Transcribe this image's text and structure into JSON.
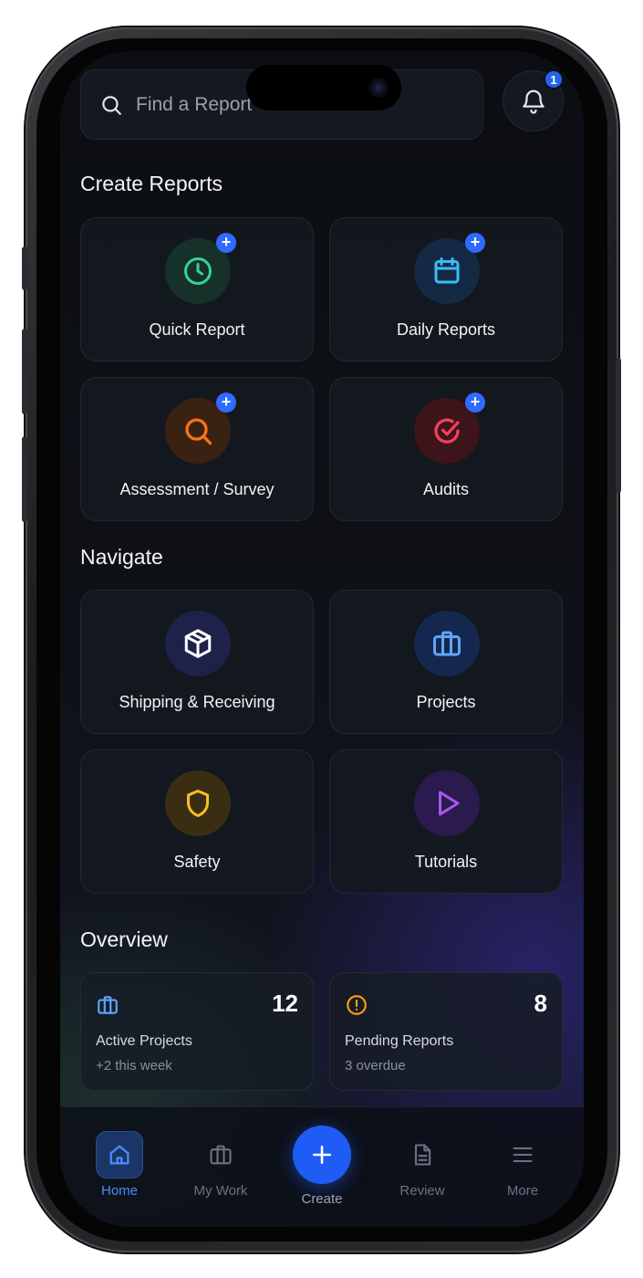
{
  "search": {
    "placeholder": "Find a Report"
  },
  "notifications": {
    "count": "1"
  },
  "sections": {
    "create_reports": "Create Reports",
    "navigate": "Navigate",
    "overview": "Overview"
  },
  "create_reports": [
    {
      "label": "Quick Report",
      "icon": "clock-icon",
      "color": "#34d399"
    },
    {
      "label": "Daily Reports",
      "icon": "calendar-icon",
      "color": "#38bdf8"
    },
    {
      "label": "Assessment / Survey",
      "icon": "search-icon",
      "color": "#f97316"
    },
    {
      "label": "Audits",
      "icon": "check-circle-icon",
      "color": "#f43f5e"
    }
  ],
  "navigate": [
    {
      "label": "Shipping & Receiving",
      "icon": "package-icon",
      "color": "#ffffff"
    },
    {
      "label": "Projects",
      "icon": "briefcase-icon",
      "color": "#60a5fa"
    },
    {
      "label": "Safety",
      "icon": "shield-icon",
      "color": "#fbbf24"
    },
    {
      "label": "Tutorials",
      "icon": "play-icon",
      "color": "#a855f7"
    }
  ],
  "overview": [
    {
      "value": "12",
      "title": "Active Projects",
      "sub": "+2 this week",
      "icon": "briefcase-icon",
      "color": "#60a5fa"
    },
    {
      "value": "8",
      "title": "Pending Reports",
      "sub": "3 overdue",
      "icon": "alert-circle-icon",
      "color": "#f59e0b"
    }
  ],
  "tabbar": {
    "home": "Home",
    "my_work": "My Work",
    "create": "Create",
    "review": "Review",
    "more": "More",
    "active_color": "#4a8bff"
  }
}
